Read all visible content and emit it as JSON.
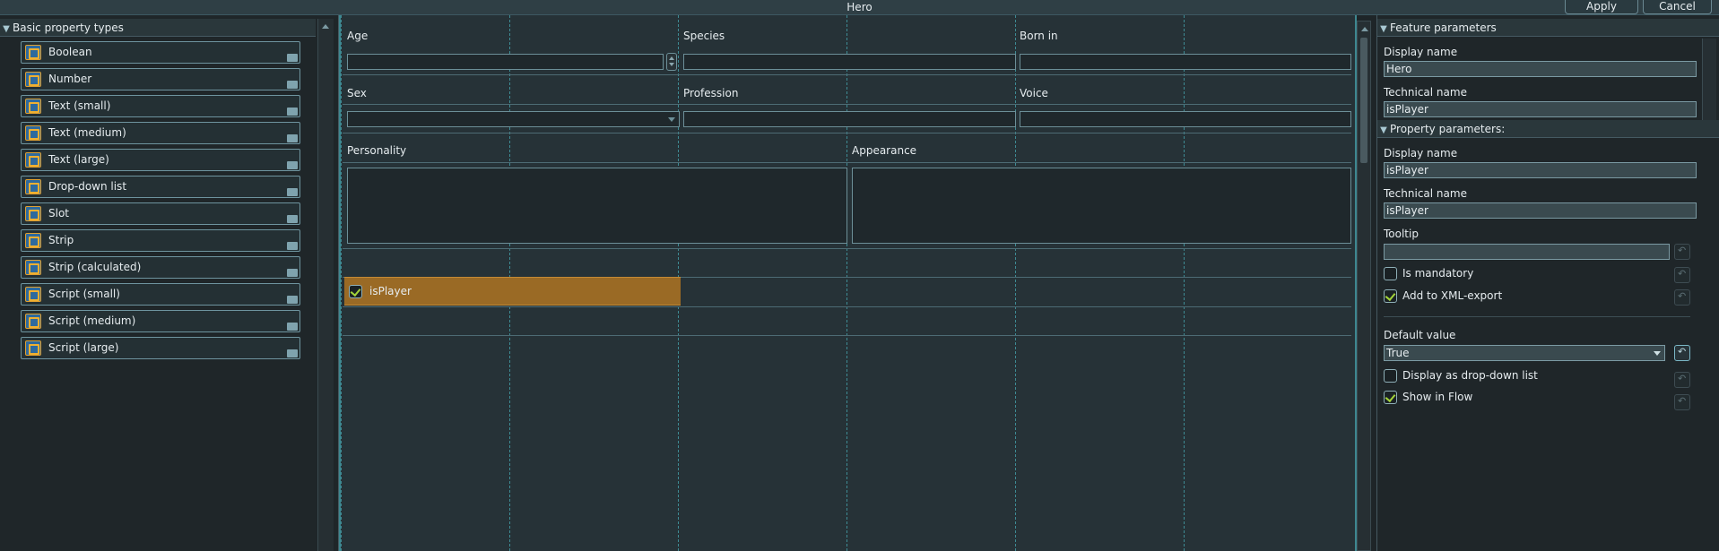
{
  "window": {
    "title": "Hero",
    "apply_label": "Apply",
    "cancel_label": "Cancel"
  },
  "palette": {
    "header": "Basic property types",
    "items": [
      "Boolean",
      "Number",
      "Text (small)",
      "Text (medium)",
      "Text (large)",
      "Drop-down list",
      "Slot",
      "Strip",
      "Strip (calculated)",
      "Script (small)",
      "Script (medium)",
      "Script (large)"
    ]
  },
  "canvas": {
    "labels": {
      "age": "Age",
      "species": "Species",
      "born_in": "Born in",
      "sex": "Sex",
      "profession": "Profession",
      "voice": "Voice",
      "personality": "Personality",
      "appearance": "Appearance"
    },
    "selected_property": {
      "label": "isPlayer",
      "checked": true
    }
  },
  "feature_params": {
    "header": "Feature parameters",
    "display_name_label": "Display name",
    "display_name_value": "Hero",
    "technical_name_label": "Technical name",
    "technical_name_value": "isPlayer"
  },
  "property_params": {
    "header": "Property parameters:",
    "display_name_label": "Display name",
    "display_name_value": "isPlayer",
    "technical_name_label": "Technical name",
    "technical_name_value": "isPlayer",
    "tooltip_label": "Tooltip",
    "tooltip_value": "",
    "is_mandatory_label": "Is mandatory",
    "is_mandatory": false,
    "xml_export_label": "Add to XML-export",
    "xml_export": true,
    "default_value_label": "Default value",
    "default_value": "True",
    "display_dropdown_label": "Display as drop-down list",
    "display_dropdown": false,
    "show_in_flow_label": "Show in Flow",
    "show_in_flow": true
  },
  "colors": {
    "accent": "#3e8790",
    "selection": "#9a6a25",
    "check": "#a3d43a"
  }
}
